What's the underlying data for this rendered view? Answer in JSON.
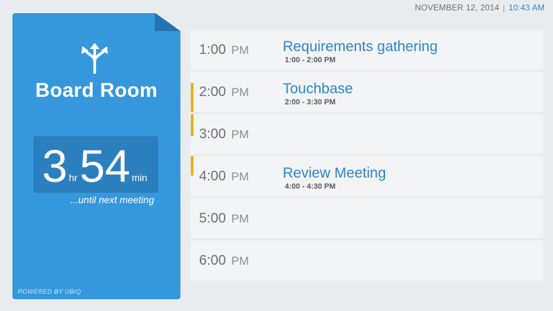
{
  "header": {
    "date": "NOVEMBER 12, 2014",
    "separator": "|",
    "time": "10:43 AM"
  },
  "room": {
    "icon": "directions-split-icon",
    "name": "Board Room",
    "timer": {
      "hours": "3",
      "hours_unit": "hr",
      "minutes": "54",
      "minutes_unit": "min"
    },
    "until_text": "...until next meeting",
    "powered_by": "POWERED BY UBIQ"
  },
  "colors": {
    "card": "#3598dc",
    "accent_bar": "#e8b419",
    "event_title": "#2f84c9",
    "time_text": "#2f84c9"
  },
  "schedule": [
    {
      "time": "1:00",
      "ampm": "PM",
      "event_title": "Requirements gathering",
      "event_range": "1:00 - 2:00 PM"
    },
    {
      "time": "2:00",
      "ampm": "PM",
      "event_title": "Touchbase",
      "event_range": "2:00 - 3:30 PM"
    },
    {
      "time": "3:00",
      "ampm": "PM",
      "event_title": "",
      "event_range": ""
    },
    {
      "time": "4:00",
      "ampm": "PM",
      "event_title": "Review Meeting",
      "event_range": "4:00 - 4:30 PM"
    },
    {
      "time": "5:00",
      "ampm": "PM",
      "event_title": "",
      "event_range": ""
    },
    {
      "time": "6:00",
      "ampm": "PM",
      "event_title": "",
      "event_range": ""
    }
  ]
}
